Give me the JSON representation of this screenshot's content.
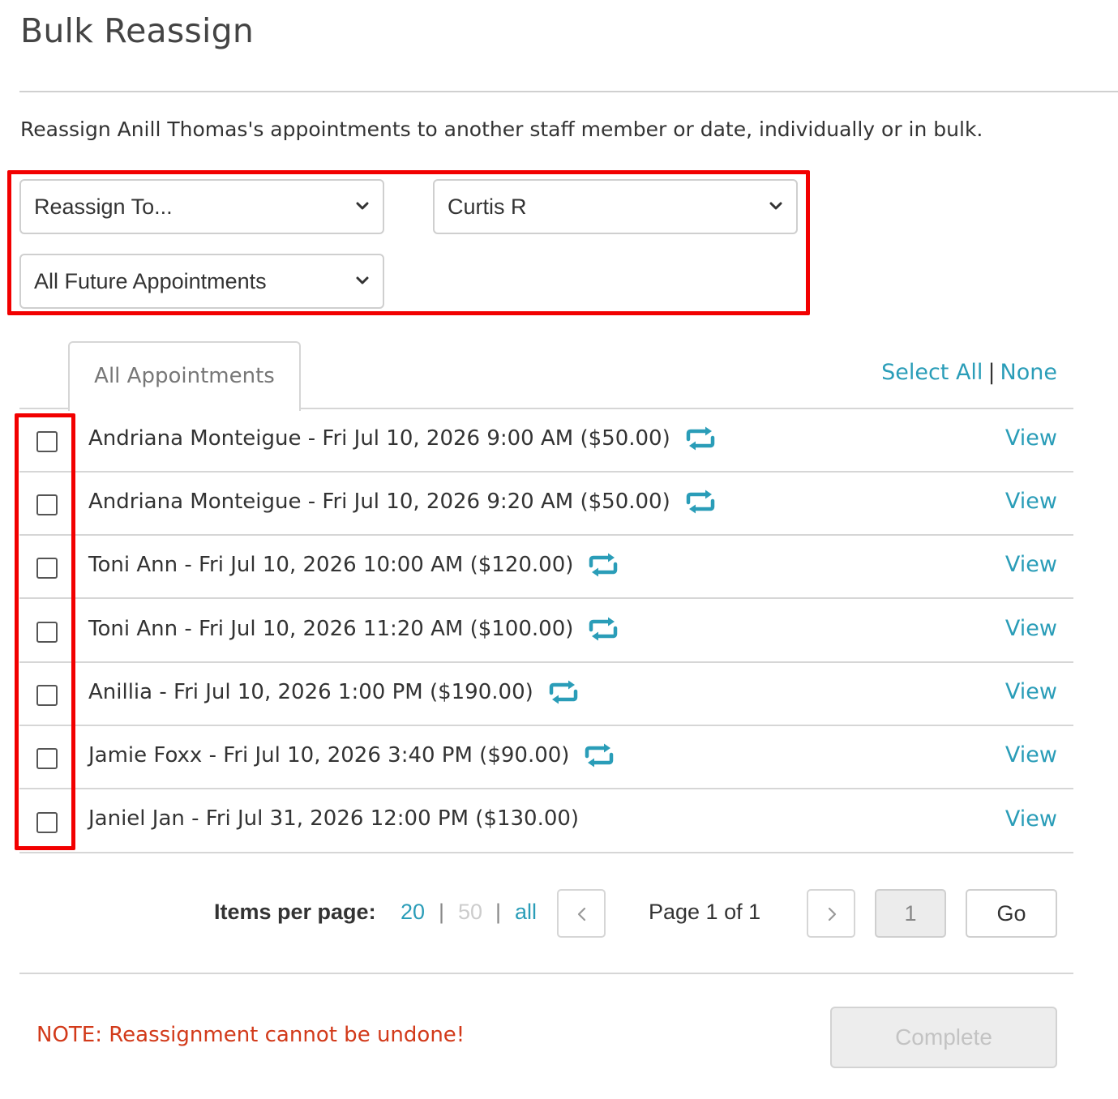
{
  "page": {
    "title": "Bulk Reassign",
    "description": "Reassign Anill Thomas's appointments to another staff member or date, individually or in bulk."
  },
  "filters": {
    "reassign_to": "Reassign To...",
    "staff": "Curtis R",
    "scope": "All Future Appointments"
  },
  "tabs": {
    "active": "All Appointments"
  },
  "selection": {
    "select_all": "Select All",
    "separator": "|",
    "none": "None"
  },
  "appointments": [
    {
      "text": "Andriana Monteigue - Fri Jul 10, 2026 9:00 AM ($50.00)",
      "recurring": true,
      "view": "View"
    },
    {
      "text": "Andriana Monteigue - Fri Jul 10, 2026 9:20 AM ($50.00)",
      "recurring": true,
      "view": "View"
    },
    {
      "text": "Toni Ann - Fri Jul 10, 2026 10:00 AM ($120.00)",
      "recurring": true,
      "view": "View"
    },
    {
      "text": "Toni Ann - Fri Jul 10, 2026 11:20 AM ($100.00)",
      "recurring": true,
      "view": "View"
    },
    {
      "text": "Anillia - Fri Jul 10, 2026 1:00 PM ($190.00)",
      "recurring": true,
      "view": "View"
    },
    {
      "text": "Jamie Foxx - Fri Jul 10, 2026 3:40 PM ($90.00)",
      "recurring": true,
      "view": "View"
    },
    {
      "text": "Janiel Jan - Fri Jul 31, 2026 12:00 PM ($130.00)",
      "recurring": false,
      "view": "View"
    }
  ],
  "pagination": {
    "items_per_page_label": "Items per page:",
    "option_20": "20",
    "option_50": "50",
    "option_all": "all",
    "sep": "|",
    "page_info": "Page 1 of 1",
    "page_input": "1",
    "go": "Go"
  },
  "footer": {
    "note": "NOTE: Reassignment cannot be undone!",
    "complete": "Complete"
  },
  "colors": {
    "link": "#2a9db8",
    "highlight": "#f20000",
    "note": "#d23a1a"
  }
}
